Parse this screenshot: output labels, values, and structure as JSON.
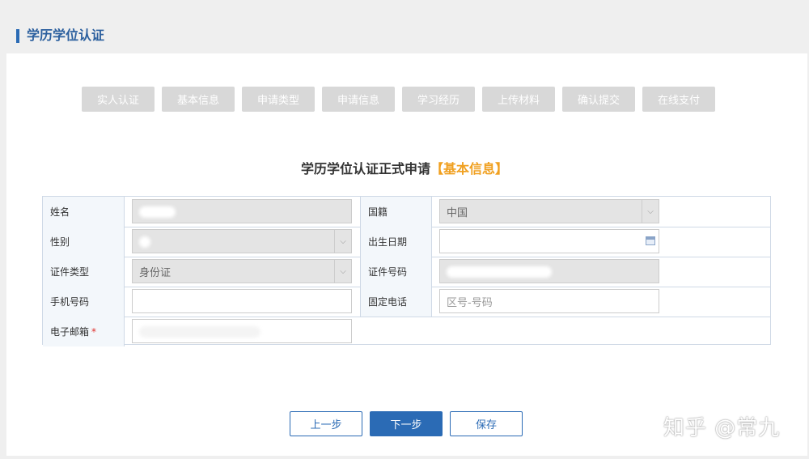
{
  "page": {
    "title": "学历学位认证"
  },
  "steps": [
    "实人认证",
    "基本信息",
    "申请类型",
    "申请信息",
    "学习经历",
    "上传材料",
    "确认提交",
    "在线支付"
  ],
  "form": {
    "title": "学历学位认证正式申请",
    "highlight": "【基本信息】",
    "rows": [
      {
        "label1": "姓名",
        "value1": "",
        "label2": "国籍",
        "value2": "中国"
      },
      {
        "label1": "性别",
        "value1": "",
        "label2": "出生日期",
        "value2": ""
      },
      {
        "label1": "证件类型",
        "value1": "身份证",
        "label2": "证件号码",
        "value2": ""
      },
      {
        "label1": "手机号码",
        "value1": "",
        "label2": "固定电话",
        "placeholder2": "区号-号码"
      },
      {
        "label1": "电子邮箱",
        "required_mark": "*",
        "value1": ""
      }
    ]
  },
  "buttons": {
    "prev": "上一步",
    "next": "下一步",
    "save": "保存"
  },
  "watermark": "知乎 @常九",
  "colors": {
    "accent": "#2b6bb5",
    "highlight": "#f0a020",
    "step_bg": "#d8d8d8",
    "required": "#e0302c"
  }
}
